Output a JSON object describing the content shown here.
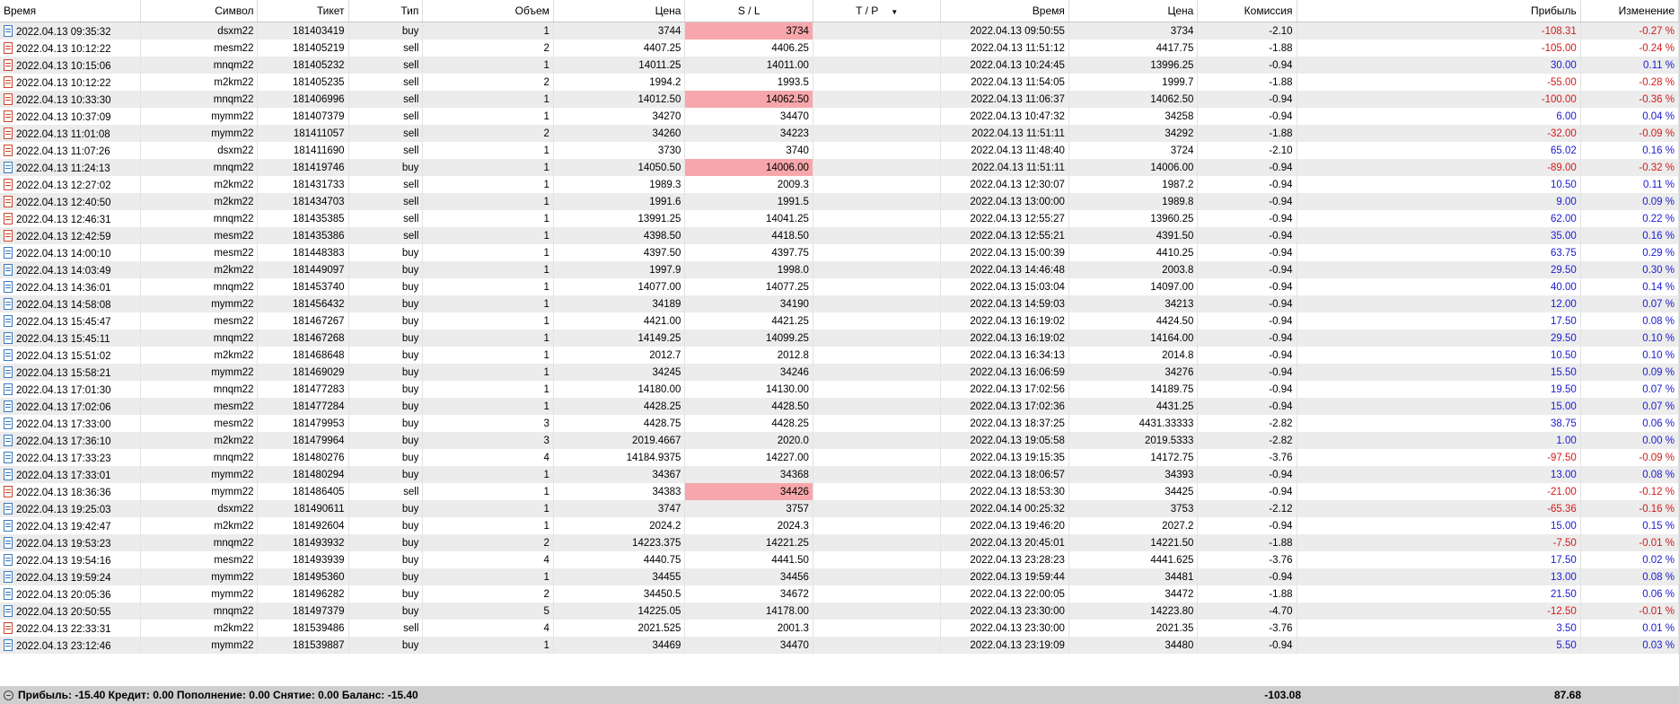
{
  "headers": {
    "time_open": "Время",
    "symbol": "Символ",
    "ticket": "Тикет",
    "type": "Тип",
    "volume": "Объем",
    "price_open": "Цена",
    "sl": "S / L",
    "tp": "T / P",
    "time_close": "Время",
    "price_close": "Цена",
    "commission": "Комиссия",
    "profit": "Прибыль",
    "change": "Изменение"
  },
  "rows": [
    {
      "time": "2022.04.13 09:35:32",
      "symbol": "dsxm22",
      "ticket": "181403419",
      "type": "buy",
      "volume": "1",
      "price": "3744",
      "sl": "3734",
      "tp": "",
      "time2": "2022.04.13 09:50:55",
      "price2": "3734",
      "comm": "-2.10",
      "profit": "-108.31",
      "change": "-0.27 %",
      "sl_hit": true
    },
    {
      "time": "2022.04.13 10:12:22",
      "symbol": "mesm22",
      "ticket": "181405219",
      "type": "sell",
      "volume": "2",
      "price": "4407.25",
      "sl": "4406.25",
      "tp": "",
      "time2": "2022.04.13 11:51:12",
      "price2": "4417.75",
      "comm": "-1.88",
      "profit": "-105.00",
      "change": "-0.24 %",
      "sl_hit": false
    },
    {
      "time": "2022.04.13 10:15:06",
      "symbol": "mnqm22",
      "ticket": "181405232",
      "type": "sell",
      "volume": "1",
      "price": "14011.25",
      "sl": "14011.00",
      "tp": "",
      "time2": "2022.04.13 10:24:45",
      "price2": "13996.25",
      "comm": "-0.94",
      "profit": "30.00",
      "change": "0.11 %",
      "sl_hit": false
    },
    {
      "time": "2022.04.13 10:12:22",
      "symbol": "m2km22",
      "ticket": "181405235",
      "type": "sell",
      "volume": "2",
      "price": "1994.2",
      "sl": "1993.5",
      "tp": "",
      "time2": "2022.04.13 11:54:05",
      "price2": "1999.7",
      "comm": "-1.88",
      "profit": "-55.00",
      "change": "-0.28 %",
      "sl_hit": false
    },
    {
      "time": "2022.04.13 10:33:30",
      "symbol": "mnqm22",
      "ticket": "181406996",
      "type": "sell",
      "volume": "1",
      "price": "14012.50",
      "sl": "14062.50",
      "tp": "",
      "time2": "2022.04.13 11:06:37",
      "price2": "14062.50",
      "comm": "-0.94",
      "profit": "-100.00",
      "change": "-0.36 %",
      "sl_hit": true
    },
    {
      "time": "2022.04.13 10:37:09",
      "symbol": "mymm22",
      "ticket": "181407379",
      "type": "sell",
      "volume": "1",
      "price": "34270",
      "sl": "34470",
      "tp": "",
      "time2": "2022.04.13 10:47:32",
      "price2": "34258",
      "comm": "-0.94",
      "profit": "6.00",
      "change": "0.04 %",
      "sl_hit": false
    },
    {
      "time": "2022.04.13 11:01:08",
      "symbol": "mymm22",
      "ticket": "181411057",
      "type": "sell",
      "volume": "2",
      "price": "34260",
      "sl": "34223",
      "tp": "",
      "time2": "2022.04.13 11:51:11",
      "price2": "34292",
      "comm": "-1.88",
      "profit": "-32.00",
      "change": "-0.09 %",
      "sl_hit": false
    },
    {
      "time": "2022.04.13 11:07:26",
      "symbol": "dsxm22",
      "ticket": "181411690",
      "type": "sell",
      "volume": "1",
      "price": "3730",
      "sl": "3740",
      "tp": "",
      "time2": "2022.04.13 11:48:40",
      "price2": "3724",
      "comm": "-2.10",
      "profit": "65.02",
      "change": "0.16 %",
      "sl_hit": false
    },
    {
      "time": "2022.04.13 11:24:13",
      "symbol": "mnqm22",
      "ticket": "181419746",
      "type": "buy",
      "volume": "1",
      "price": "14050.50",
      "sl": "14006.00",
      "tp": "",
      "time2": "2022.04.13 11:51:11",
      "price2": "14006.00",
      "comm": "-0.94",
      "profit": "-89.00",
      "change": "-0.32 %",
      "sl_hit": true
    },
    {
      "time": "2022.04.13 12:27:02",
      "symbol": "m2km22",
      "ticket": "181431733",
      "type": "sell",
      "volume": "1",
      "price": "1989.3",
      "sl": "2009.3",
      "tp": "",
      "time2": "2022.04.13 12:30:07",
      "price2": "1987.2",
      "comm": "-0.94",
      "profit": "10.50",
      "change": "0.11 %",
      "sl_hit": false
    },
    {
      "time": "2022.04.13 12:40:50",
      "symbol": "m2km22",
      "ticket": "181434703",
      "type": "sell",
      "volume": "1",
      "price": "1991.6",
      "sl": "1991.5",
      "tp": "",
      "time2": "2022.04.13 13:00:00",
      "price2": "1989.8",
      "comm": "-0.94",
      "profit": "9.00",
      "change": "0.09 %",
      "sl_hit": false
    },
    {
      "time": "2022.04.13 12:46:31",
      "symbol": "mnqm22",
      "ticket": "181435385",
      "type": "sell",
      "volume": "1",
      "price": "13991.25",
      "sl": "14041.25",
      "tp": "",
      "time2": "2022.04.13 12:55:27",
      "price2": "13960.25",
      "comm": "-0.94",
      "profit": "62.00",
      "change": "0.22 %",
      "sl_hit": false
    },
    {
      "time": "2022.04.13 12:42:59",
      "symbol": "mesm22",
      "ticket": "181435386",
      "type": "sell",
      "volume": "1",
      "price": "4398.50",
      "sl": "4418.50",
      "tp": "",
      "time2": "2022.04.13 12:55:21",
      "price2": "4391.50",
      "comm": "-0.94",
      "profit": "35.00",
      "change": "0.16 %",
      "sl_hit": false
    },
    {
      "time": "2022.04.13 14:00:10",
      "symbol": "mesm22",
      "ticket": "181448383",
      "type": "buy",
      "volume": "1",
      "price": "4397.50",
      "sl": "4397.75",
      "tp": "",
      "time2": "2022.04.13 15:00:39",
      "price2": "4410.25",
      "comm": "-0.94",
      "profit": "63.75",
      "change": "0.29 %",
      "sl_hit": false
    },
    {
      "time": "2022.04.13 14:03:49",
      "symbol": "m2km22",
      "ticket": "181449097",
      "type": "buy",
      "volume": "1",
      "price": "1997.9",
      "sl": "1998.0",
      "tp": "",
      "time2": "2022.04.13 14:46:48",
      "price2": "2003.8",
      "comm": "-0.94",
      "profit": "29.50",
      "change": "0.30 %",
      "sl_hit": false
    },
    {
      "time": "2022.04.13 14:36:01",
      "symbol": "mnqm22",
      "ticket": "181453740",
      "type": "buy",
      "volume": "1",
      "price": "14077.00",
      "sl": "14077.25",
      "tp": "",
      "time2": "2022.04.13 15:03:04",
      "price2": "14097.00",
      "comm": "-0.94",
      "profit": "40.00",
      "change": "0.14 %",
      "sl_hit": false
    },
    {
      "time": "2022.04.13 14:58:08",
      "symbol": "mymm22",
      "ticket": "181456432",
      "type": "buy",
      "volume": "1",
      "price": "34189",
      "sl": "34190",
      "tp": "",
      "time2": "2022.04.13 14:59:03",
      "price2": "34213",
      "comm": "-0.94",
      "profit": "12.00",
      "change": "0.07 %",
      "sl_hit": false
    },
    {
      "time": "2022.04.13 15:45:47",
      "symbol": "mesm22",
      "ticket": "181467267",
      "type": "buy",
      "volume": "1",
      "price": "4421.00",
      "sl": "4421.25",
      "tp": "",
      "time2": "2022.04.13 16:19:02",
      "price2": "4424.50",
      "comm": "-0.94",
      "profit": "17.50",
      "change": "0.08 %",
      "sl_hit": false
    },
    {
      "time": "2022.04.13 15:45:11",
      "symbol": "mnqm22",
      "ticket": "181467268",
      "type": "buy",
      "volume": "1",
      "price": "14149.25",
      "sl": "14099.25",
      "tp": "",
      "time2": "2022.04.13 16:19:02",
      "price2": "14164.00",
      "comm": "-0.94",
      "profit": "29.50",
      "change": "0.10 %",
      "sl_hit": false
    },
    {
      "time": "2022.04.13 15:51:02",
      "symbol": "m2km22",
      "ticket": "181468648",
      "type": "buy",
      "volume": "1",
      "price": "2012.7",
      "sl": "2012.8",
      "tp": "",
      "time2": "2022.04.13 16:34:13",
      "price2": "2014.8",
      "comm": "-0.94",
      "profit": "10.50",
      "change": "0.10 %",
      "sl_hit": false
    },
    {
      "time": "2022.04.13 15:58:21",
      "symbol": "mymm22",
      "ticket": "181469029",
      "type": "buy",
      "volume": "1",
      "price": "34245",
      "sl": "34246",
      "tp": "",
      "time2": "2022.04.13 16:06:59",
      "price2": "34276",
      "comm": "-0.94",
      "profit": "15.50",
      "change": "0.09 %",
      "sl_hit": false
    },
    {
      "time": "2022.04.13 17:01:30",
      "symbol": "mnqm22",
      "ticket": "181477283",
      "type": "buy",
      "volume": "1",
      "price": "14180.00",
      "sl": "14130.00",
      "tp": "",
      "time2": "2022.04.13 17:02:56",
      "price2": "14189.75",
      "comm": "-0.94",
      "profit": "19.50",
      "change": "0.07 %",
      "sl_hit": false
    },
    {
      "time": "2022.04.13 17:02:06",
      "symbol": "mesm22",
      "ticket": "181477284",
      "type": "buy",
      "volume": "1",
      "price": "4428.25",
      "sl": "4428.50",
      "tp": "",
      "time2": "2022.04.13 17:02:36",
      "price2": "4431.25",
      "comm": "-0.94",
      "profit": "15.00",
      "change": "0.07 %",
      "sl_hit": false
    },
    {
      "time": "2022.04.13 17:33:00",
      "symbol": "mesm22",
      "ticket": "181479953",
      "type": "buy",
      "volume": "3",
      "price": "4428.75",
      "sl": "4428.25",
      "tp": "",
      "time2": "2022.04.13 18:37:25",
      "price2": "4431.33333",
      "comm": "-2.82",
      "profit": "38.75",
      "change": "0.06 %",
      "sl_hit": false
    },
    {
      "time": "2022.04.13 17:36:10",
      "symbol": "m2km22",
      "ticket": "181479964",
      "type": "buy",
      "volume": "3",
      "price": "2019.4667",
      "sl": "2020.0",
      "tp": "",
      "time2": "2022.04.13 19:05:58",
      "price2": "2019.5333",
      "comm": "-2.82",
      "profit": "1.00",
      "change": "0.00 %",
      "sl_hit": false
    },
    {
      "time": "2022.04.13 17:33:23",
      "symbol": "mnqm22",
      "ticket": "181480276",
      "type": "buy",
      "volume": "4",
      "price": "14184.9375",
      "sl": "14227.00",
      "tp": "",
      "time2": "2022.04.13 19:15:35",
      "price2": "14172.75",
      "comm": "-3.76",
      "profit": "-97.50",
      "change": "-0.09 %",
      "sl_hit": false
    },
    {
      "time": "2022.04.13 17:33:01",
      "symbol": "mymm22",
      "ticket": "181480294",
      "type": "buy",
      "volume": "1",
      "price": "34367",
      "sl": "34368",
      "tp": "",
      "time2": "2022.04.13 18:06:57",
      "price2": "34393",
      "comm": "-0.94",
      "profit": "13.00",
      "change": "0.08 %",
      "sl_hit": false
    },
    {
      "time": "2022.04.13 18:36:36",
      "symbol": "mymm22",
      "ticket": "181486405",
      "type": "sell",
      "volume": "1",
      "price": "34383",
      "sl": "34426",
      "tp": "",
      "time2": "2022.04.13 18:53:30",
      "price2": "34425",
      "comm": "-0.94",
      "profit": "-21.00",
      "change": "-0.12 %",
      "sl_hit": true
    },
    {
      "time": "2022.04.13 19:25:03",
      "symbol": "dsxm22",
      "ticket": "181490611",
      "type": "buy",
      "volume": "1",
      "price": "3747",
      "sl": "3757",
      "tp": "",
      "time2": "2022.04.14 00:25:32",
      "price2": "3753",
      "comm": "-2.12",
      "profit": "-65.36",
      "change": "-0.16 %",
      "sl_hit": false
    },
    {
      "time": "2022.04.13 19:42:47",
      "symbol": "m2km22",
      "ticket": "181492604",
      "type": "buy",
      "volume": "1",
      "price": "2024.2",
      "sl": "2024.3",
      "tp": "",
      "time2": "2022.04.13 19:46:20",
      "price2": "2027.2",
      "comm": "-0.94",
      "profit": "15.00",
      "change": "0.15 %",
      "sl_hit": false
    },
    {
      "time": "2022.04.13 19:53:23",
      "symbol": "mnqm22",
      "ticket": "181493932",
      "type": "buy",
      "volume": "2",
      "price": "14223.375",
      "sl": "14221.25",
      "tp": "",
      "time2": "2022.04.13 20:45:01",
      "price2": "14221.50",
      "comm": "-1.88",
      "profit": "-7.50",
      "change": "-0.01 %",
      "sl_hit": false
    },
    {
      "time": "2022.04.13 19:54:16",
      "symbol": "mesm22",
      "ticket": "181493939",
      "type": "buy",
      "volume": "4",
      "price": "4440.75",
      "sl": "4441.50",
      "tp": "",
      "time2": "2022.04.13 23:28:23",
      "price2": "4441.625",
      "comm": "-3.76",
      "profit": "17.50",
      "change": "0.02 %",
      "sl_hit": false
    },
    {
      "time": "2022.04.13 19:59:24",
      "symbol": "mymm22",
      "ticket": "181495360",
      "type": "buy",
      "volume": "1",
      "price": "34455",
      "sl": "34456",
      "tp": "",
      "time2": "2022.04.13 19:59:44",
      "price2": "34481",
      "comm": "-0.94",
      "profit": "13.00",
      "change": "0.08 %",
      "sl_hit": false
    },
    {
      "time": "2022.04.13 20:05:36",
      "symbol": "mymm22",
      "ticket": "181496282",
      "type": "buy",
      "volume": "2",
      "price": "34450.5",
      "sl": "34672",
      "tp": "",
      "time2": "2022.04.13 22:00:05",
      "price2": "34472",
      "comm": "-1.88",
      "profit": "21.50",
      "change": "0.06 %",
      "sl_hit": false
    },
    {
      "time": "2022.04.13 20:50:55",
      "symbol": "mnqm22",
      "ticket": "181497379",
      "type": "buy",
      "volume": "5",
      "price": "14225.05",
      "sl": "14178.00",
      "tp": "",
      "time2": "2022.04.13 23:30:00",
      "price2": "14223.80",
      "comm": "-4.70",
      "profit": "-12.50",
      "change": "-0.01 %",
      "sl_hit": false
    },
    {
      "time": "2022.04.13 22:33:31",
      "symbol": "m2km22",
      "ticket": "181539486",
      "type": "sell",
      "volume": "4",
      "price": "2021.525",
      "sl": "2001.3",
      "tp": "",
      "time2": "2022.04.13 23:30:00",
      "price2": "2021.35",
      "comm": "-3.76",
      "profit": "3.50",
      "change": "0.01 %",
      "sl_hit": false
    },
    {
      "time": "2022.04.13 23:12:46",
      "symbol": "mymm22",
      "ticket": "181539887",
      "type": "buy",
      "volume": "1",
      "price": "34469",
      "sl": "34470",
      "tp": "",
      "time2": "2022.04.13 23:19:09",
      "price2": "34480",
      "comm": "-0.94",
      "profit": "5.50",
      "change": "0.03 %",
      "sl_hit": false
    }
  ],
  "summary": {
    "text": "Прибыль: -15.40  Кредит: 0.00  Пополнение: 0.00  Снятие: 0.00  Баланс: -15.40",
    "commission_total": "-103.08",
    "profit_total": "87.68"
  },
  "colors": {
    "negative": "#d11a1a",
    "positive": "#1a1ad1",
    "sl_highlight": "#f7a7ab",
    "row_alt": "#ececec",
    "summary_bg": "#cfcfcf",
    "buy_icon": "#3a7bbf",
    "sell_icon": "#c9462c"
  },
  "icons": {
    "row": "document-icon",
    "summary": "collapse-circle-icon",
    "sort": "sort-down-arrow"
  }
}
